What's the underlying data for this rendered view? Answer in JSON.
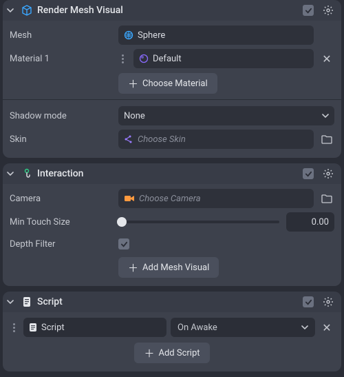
{
  "components": {
    "renderMesh": {
      "title": "Render Mesh Visual",
      "enabled": true,
      "fields": {
        "mesh_label": "Mesh",
        "mesh_value": "Sphere",
        "material_label": "Material 1",
        "material_value": "Default",
        "choose_material_btn": "Choose Material",
        "shadow_label": "Shadow mode",
        "shadow_value": "None",
        "skin_label": "Skin",
        "skin_placeholder": "Choose Skin"
      }
    },
    "interaction": {
      "title": "Interaction",
      "enabled": true,
      "fields": {
        "camera_label": "Camera",
        "camera_placeholder": "Choose Camera",
        "min_touch_label": "Min Touch Size",
        "min_touch_value": "0.00",
        "depth_filter_label": "Depth Filter",
        "depth_filter_checked": true,
        "add_mesh_btn": "Add Mesh Visual"
      }
    },
    "script": {
      "title": "Script",
      "enabled": true,
      "fields": {
        "script_label": "Script",
        "event_value": "On Awake",
        "add_script_btn": "Add Script"
      }
    }
  },
  "icons": {
    "mesh_color": "#3aa7ff",
    "material_color": "#8a6bff",
    "skin_color": "#9a7bff",
    "camera_color": "#ff9a3f",
    "interaction_color": "#2fd088"
  }
}
